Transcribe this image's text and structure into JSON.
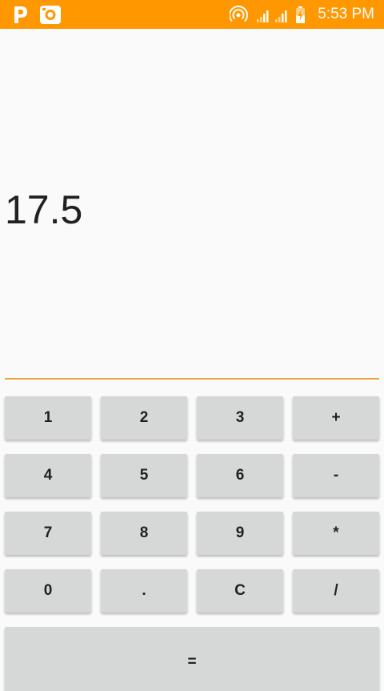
{
  "status_bar": {
    "time": "5:53 PM",
    "icons": [
      "p-app-icon",
      "screenshot-app-icon",
      "hotspot-icon",
      "signal-1-icon",
      "signal-2-icon",
      "battery-charging-icon"
    ]
  },
  "display": {
    "value": "17.5"
  },
  "colors": {
    "status_bar": "#ff9800",
    "accent_line": "#e8a23c",
    "key_bg": "#d6d7d7",
    "background": "#fafafa"
  },
  "keys": {
    "k1": "1",
    "k2": "2",
    "k3": "3",
    "plus": "+",
    "k4": "4",
    "k5": "5",
    "k6": "6",
    "minus": "-",
    "k7": "7",
    "k8": "8",
    "k9": "9",
    "multiply": "*",
    "k0": "0",
    "dot": ".",
    "clear": "C",
    "divide": "/",
    "equals": "="
  }
}
